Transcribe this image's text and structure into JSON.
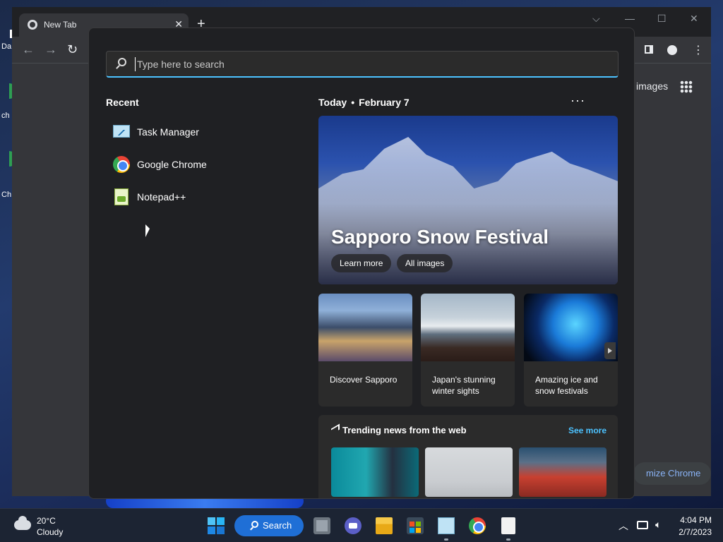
{
  "desktop": {
    "labels": [
      "Da",
      "ch",
      "Ch"
    ]
  },
  "chrome": {
    "tab_title": "New Tab",
    "tab_close": "✕",
    "new_tab": "+",
    "images_link": "images",
    "customize_label": "mize Chrome",
    "controls": {
      "dropdown": "⌵",
      "minimize": "—",
      "maximize": "☐",
      "close": "✕"
    },
    "nav": {
      "back": "←",
      "forward": "→",
      "reload": "↻"
    }
  },
  "flyout": {
    "search": {
      "placeholder": "Type here to search",
      "value": ""
    },
    "recent": {
      "title": "Recent",
      "items": [
        {
          "label": "Task Manager",
          "icon": "task-manager-icon"
        },
        {
          "label": "Google Chrome",
          "icon": "chrome-icon"
        },
        {
          "label": "Notepad++",
          "icon": "notepad-plus-plus-icon"
        }
      ]
    },
    "highlights": {
      "day": "Today",
      "date": "February 7",
      "more": "···",
      "hero": {
        "title": "Sapporo Snow Festival",
        "buttons": [
          "Learn more",
          "All images"
        ]
      },
      "cards": [
        {
          "label": "Discover Sapporo"
        },
        {
          "label": "Japan's stunning winter sights"
        },
        {
          "label": "Amazing ice and snow festivals"
        }
      ],
      "trending": {
        "title": "Trending news from the web",
        "see_more": "See more"
      }
    }
  },
  "taskbar": {
    "weather": {
      "temp": "20°C",
      "condition": "Cloudy"
    },
    "search_label": "Search",
    "apps": [
      "start-icon",
      "task-view-icon",
      "chat-icon",
      "file-explorer-icon",
      "store-icon",
      "task-manager-icon",
      "chrome-icon",
      "notepad-icon"
    ],
    "clock": {
      "time": "4:04 PM",
      "date": "2/7/2023"
    }
  },
  "colors": {
    "accent": "#4cc2ff",
    "search_pill": "#1f6fd6",
    "flyout_bg": "#1f2023",
    "card_bg": "#2b2b2b"
  }
}
